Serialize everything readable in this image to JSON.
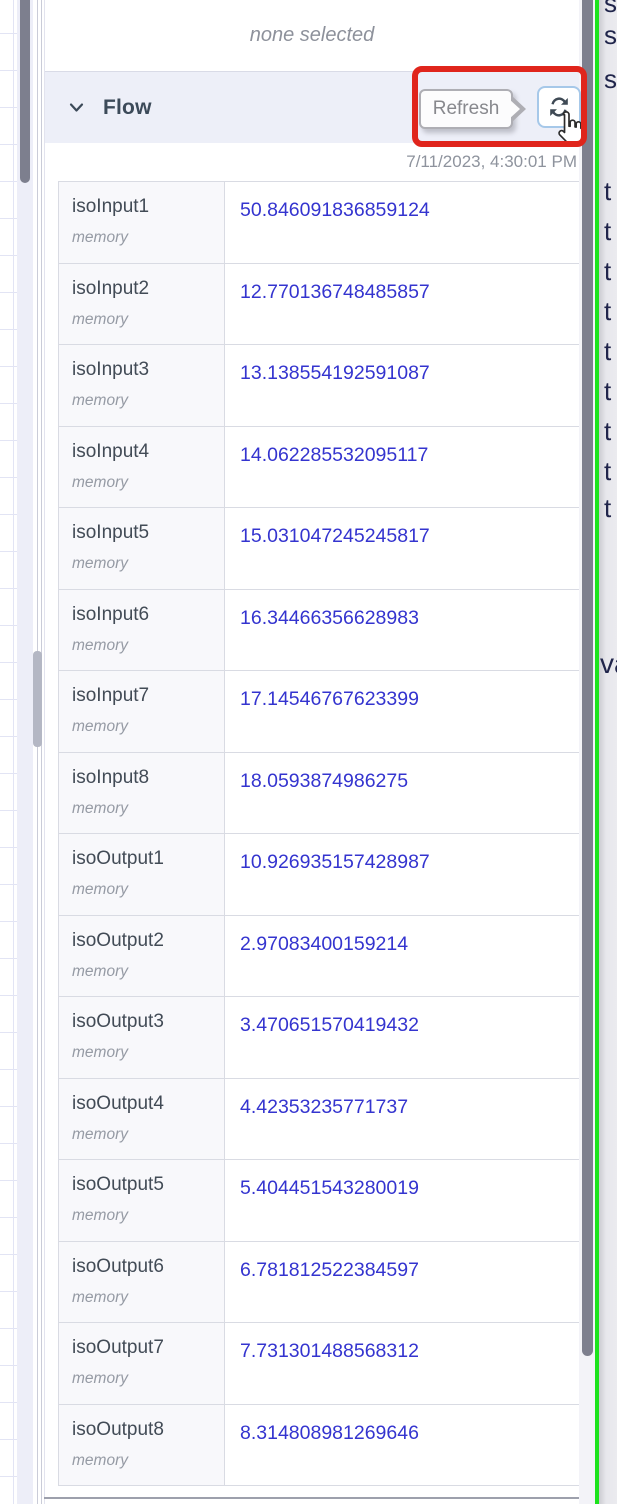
{
  "panel": {
    "selection_status": "none selected",
    "flow_section": {
      "title": "Flow",
      "chevron_icon": "chevron-down",
      "refresh_tooltip": "Refresh",
      "refresh_icon": "refresh-icon",
      "last_refresh": "7/11/2023, 4:30:01 PM"
    }
  },
  "flow_table": {
    "rows": [
      {
        "name": "isoInput1",
        "kind": "memory",
        "value": "50.846091836859124"
      },
      {
        "name": "isoInput2",
        "kind": "memory",
        "value": "12.770136748485857"
      },
      {
        "name": "isoInput3",
        "kind": "memory",
        "value": "13.138554192591087"
      },
      {
        "name": "isoInput4",
        "kind": "memory",
        "value": "14.062285532095117"
      },
      {
        "name": "isoInput5",
        "kind": "memory",
        "value": "15.031047245245817"
      },
      {
        "name": "isoInput6",
        "kind": "memory",
        "value": "16.34466356628983"
      },
      {
        "name": "isoInput7",
        "kind": "memory",
        "value": "17.14546767623399"
      },
      {
        "name": "isoInput8",
        "kind": "memory",
        "value": "18.0593874986275"
      },
      {
        "name": "isoOutput1",
        "kind": "memory",
        "value": "10.926935157428987"
      },
      {
        "name": "isoOutput2",
        "kind": "memory",
        "value": "2.97083400159214"
      },
      {
        "name": "isoOutput3",
        "kind": "memory",
        "value": "3.470651570419432"
      },
      {
        "name": "isoOutput4",
        "kind": "memory",
        "value": "4.42353235771737"
      },
      {
        "name": "isoOutput5",
        "kind": "memory",
        "value": "5.404451543280019"
      },
      {
        "name": "isoOutput6",
        "kind": "memory",
        "value": "6.781812522384597"
      },
      {
        "name": "isoOutput7",
        "kind": "memory",
        "value": "7.731301488568312"
      },
      {
        "name": "isoOutput8",
        "kind": "memory",
        "value": "8.314808981269646"
      }
    ]
  },
  "neighbour_panel": {
    "clipped_text_fragments": [
      "s",
      "s",
      "s",
      "t",
      "t",
      "t",
      "t",
      "t",
      "t",
      "t",
      "t",
      "t",
      "va"
    ]
  },
  "colors": {
    "accent_value_blue": "#3434cf",
    "section_header_bg": "#edeff8",
    "annotation_red": "#e0251c",
    "pane_divider_green": "#1ce31c",
    "refresh_button_border": "#a6c8e9"
  }
}
